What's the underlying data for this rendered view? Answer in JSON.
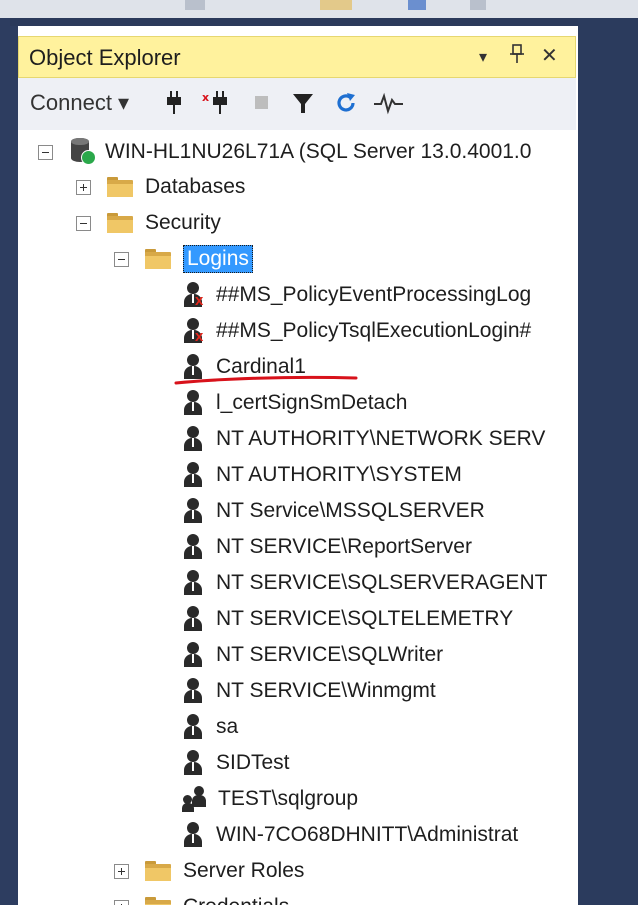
{
  "window": {
    "title": "Object Explorer",
    "controls": {
      "pin": "▾",
      "dock": "⍑",
      "close": "✕"
    }
  },
  "toolbar": {
    "connect_label": "Connect ▾",
    "icons": [
      "connect-plug-icon",
      "disconnect-plug-icon",
      "stop-icon",
      "filter-icon",
      "refresh-icon",
      "activity-monitor-icon"
    ]
  },
  "tree": {
    "server": "WIN-HL1NU26L71A (SQL Server 13.0.4001.0",
    "databases": "Databases",
    "security": "Security",
    "logins": "Logins",
    "login_items": [
      "##MS_PolicyEventProcessingLog",
      "##MS_PolicyTsqlExecutionLogin#",
      "Cardinal1",
      "l_certSignSmDetach",
      "NT AUTHORITY\\NETWORK SERV",
      "NT AUTHORITY\\SYSTEM",
      "NT Service\\MSSQLSERVER",
      "NT SERVICE\\ReportServer",
      "NT SERVICE\\SQLSERVERAGENT",
      "NT SERVICE\\SQLTELEMETRY",
      "NT SERVICE\\SQLWriter",
      "NT SERVICE\\Winmgmt",
      "sa",
      "SIDTest",
      "TEST\\sqlgroup",
      "WIN-7CO68DHNITT\\Administrat"
    ],
    "server_roles": "Server Roles",
    "credentials": "Credentials"
  },
  "colors": {
    "title_bg": "#fff29d",
    "selection": "#3399ff",
    "annotation_underline": "#d8121b"
  }
}
